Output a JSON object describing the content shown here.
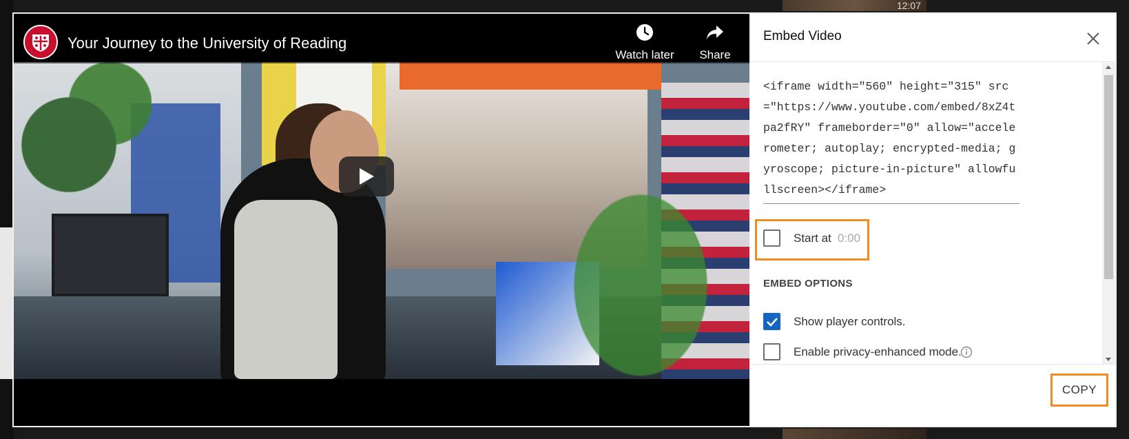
{
  "background": {
    "thumb_time": "12:07"
  },
  "player": {
    "title": "Your Journey to the University of Reading",
    "watch_later_label": "Watch later",
    "share_label": "Share"
  },
  "embed_panel": {
    "title": "Embed Video",
    "embed_code": "<iframe width=\"560\" height=\"315\" src=\"https://www.youtube.com/embed/8xZ4tpa2fRY\" frameborder=\"0\" allow=\"accelerometer; autoplay; encrypted-media; gyroscope; picture-in-picture\" allowfullscreen></iframe>",
    "start_at": {
      "label": "Start at",
      "time": "0:00",
      "checked": false
    },
    "section_heading": "EMBED OPTIONS",
    "options": [
      {
        "label": "Show player controls.",
        "checked": true
      },
      {
        "label": "Enable privacy-enhanced mode.",
        "checked": false
      }
    ],
    "copy_label": "COPY"
  },
  "colors": {
    "accent_blue": "#1565c0",
    "highlight_orange": "#f28b1e",
    "brand_red": "#c8102e"
  }
}
